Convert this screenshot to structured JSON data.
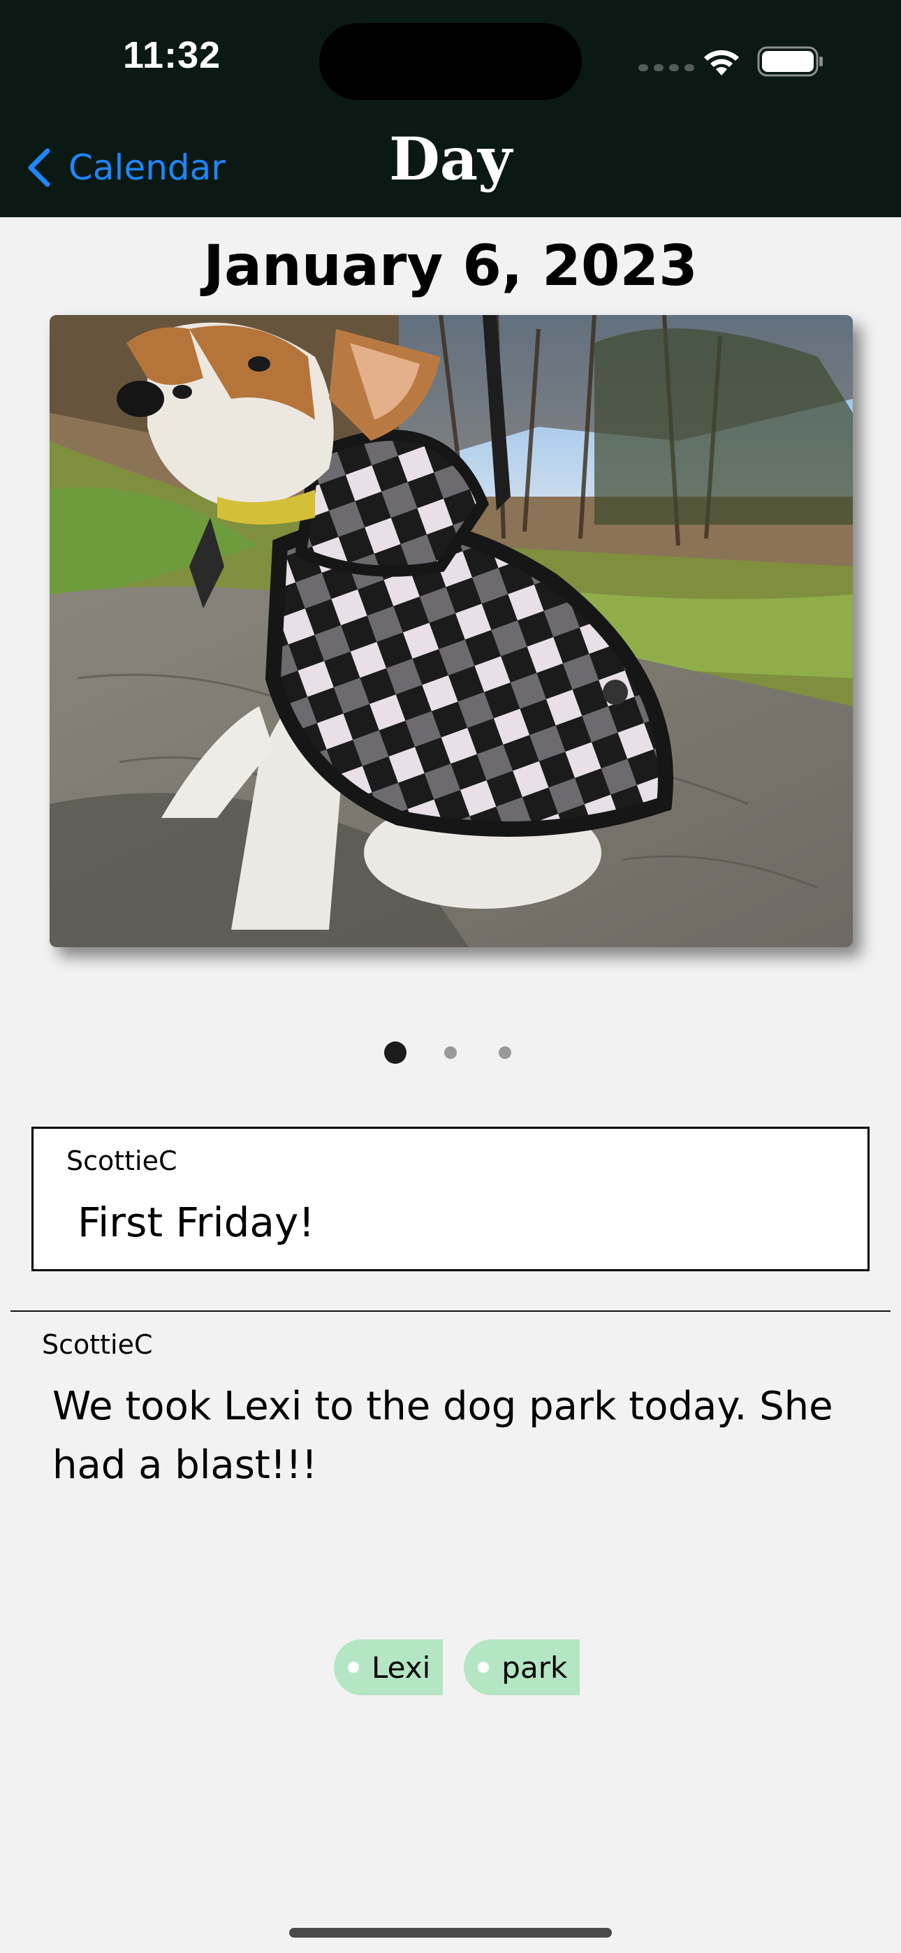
{
  "status_bar": {
    "time": "11:32"
  },
  "nav": {
    "back_label": "Calendar",
    "title": "Day"
  },
  "entry": {
    "date": "January 6, 2023",
    "photo_count": 3,
    "active_photo_index": 0,
    "title_author": "ScottieC",
    "title": "First Friday!",
    "note_author": "ScottieC",
    "note": "We took Lexi to the dog park today. She had a blast!!!",
    "tags": [
      "Lexi",
      "park"
    ]
  },
  "colors": {
    "nav_background": "#0b1914",
    "accent": "#1f86ff",
    "tag_background": "#b4e6c3",
    "page_background": "#f2f2f2"
  },
  "icons": {
    "back": "chevron-left-icon",
    "wifi": "wifi-icon",
    "battery": "battery-icon",
    "signal": "cellular-signal-icon"
  }
}
